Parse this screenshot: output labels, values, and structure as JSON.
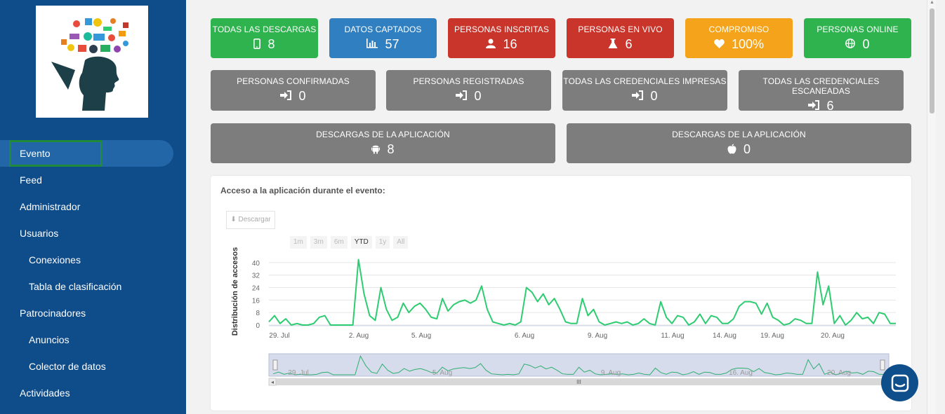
{
  "sidebar": {
    "items": [
      {
        "label": "Evento",
        "sub": false,
        "active": true
      },
      {
        "label": "Feed",
        "sub": false
      },
      {
        "label": "Administrador",
        "sub": false
      },
      {
        "label": "Usuarios",
        "sub": false
      },
      {
        "label": "Conexiones",
        "sub": true
      },
      {
        "label": "Tabla de clasificación",
        "sub": true
      },
      {
        "label": "Patrocinadores",
        "sub": false
      },
      {
        "label": "Anuncios",
        "sub": true
      },
      {
        "label": "Colector de datos",
        "sub": true
      },
      {
        "label": "Actividades",
        "sub": false
      }
    ]
  },
  "stats_row1": [
    {
      "title": "TODAS LAS DESCARGAS",
      "value": "8",
      "color": "#2fb34f",
      "icon": "mobile-icon"
    },
    {
      "title": "DATOS CAPTADOS",
      "value": "57",
      "color": "#2f7fc1",
      "icon": "bar-chart-icon"
    },
    {
      "title": "PERSONAS INSCRITAS",
      "value": "16",
      "color": "#c9352b",
      "icon": "user-icon"
    },
    {
      "title": "PERSONAS EN VIVO",
      "value": "6",
      "color": "#c9352b",
      "icon": "flask-icon"
    },
    {
      "title": "COMPROMISO",
      "value": "100%",
      "color": "#f4a31a",
      "icon": "heart-icon"
    },
    {
      "title": "PERSONAS ONLINE",
      "value": "0",
      "color": "#2fb34f",
      "icon": "globe-icon"
    }
  ],
  "stats_row2": [
    {
      "title": "PERSONAS CONFIRMADAS",
      "value": "0",
      "icon": "sign-in-icon"
    },
    {
      "title": "PERSONAS REGISTRADAS",
      "value": "0",
      "icon": "sign-in-icon"
    },
    {
      "title": "TODAS LAS CREDENCIALES IMPRESAS",
      "value": "0",
      "icon": "sign-in-icon"
    },
    {
      "title": "TODAS LAS CREDENCIALES ESCANEADAS",
      "value": "6",
      "icon": "sign-in-icon"
    }
  ],
  "stats_row3": [
    {
      "title": "DESCARGAS DE LA APLICACIÓN",
      "value": "8",
      "icon": "android-icon"
    },
    {
      "title": "DESCARGAS DE LA APLICACIÓN",
      "value": "0",
      "icon": "apple-icon"
    }
  ],
  "chart_card": {
    "title": "Acceso a la aplicación durante el evento:",
    "download_label": "⬇ Descargar",
    "ranges": [
      "1m",
      "3m",
      "6m",
      "YTD",
      "1y",
      "All"
    ],
    "selected_range": "YTD"
  },
  "chart_data": {
    "type": "line",
    "ylabel": "Distribución de accesos",
    "yticks": [
      0,
      8,
      16,
      24,
      32,
      40
    ],
    "ylim": [
      0,
      44
    ],
    "xlabels": [
      "29. Jul",
      "2. Aug",
      "5. Aug",
      "6. Aug",
      "9. Aug",
      "11. Aug",
      "14. Aug",
      "19. Aug",
      "20. Aug"
    ],
    "navigator_labels": [
      "29. Jul",
      "5. Aug",
      "9. Aug",
      "16. Aug",
      "20. Aug"
    ],
    "color": "#2ecc71",
    "grid": true,
    "values": [
      2,
      6,
      1,
      4,
      0,
      1,
      0,
      0,
      1,
      5,
      6,
      0,
      0,
      0,
      0,
      0,
      42,
      20,
      6,
      3,
      24,
      10,
      3,
      5,
      14,
      8,
      12,
      14,
      10,
      5,
      4,
      17,
      9,
      13,
      15,
      16,
      14,
      16,
      25,
      10,
      2,
      1,
      0,
      1,
      0,
      2,
      24,
      21,
      15,
      20,
      13,
      17,
      10,
      2,
      1,
      1,
      17,
      6,
      10,
      2,
      0,
      1,
      2,
      1,
      2,
      0,
      1,
      4,
      1,
      0,
      15,
      5,
      1,
      6,
      5,
      0,
      2,
      7,
      1,
      6,
      5,
      1,
      1,
      4,
      12,
      15,
      15,
      14,
      7,
      14,
      5,
      3,
      0,
      1,
      4,
      3,
      1,
      1,
      34,
      13,
      25,
      1,
      6,
      0,
      3,
      8,
      4,
      5,
      1,
      8,
      7,
      1,
      1
    ]
  }
}
